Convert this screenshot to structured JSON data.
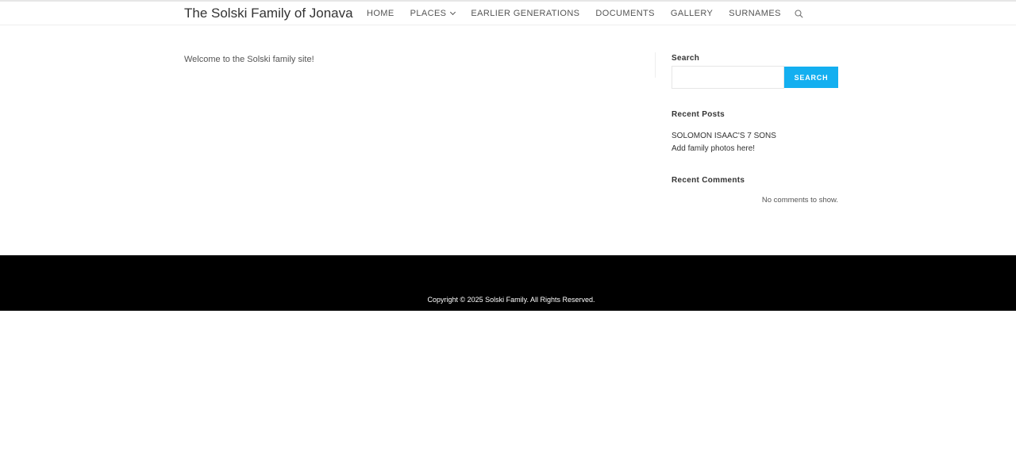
{
  "header": {
    "site_title": "The Solski Family of Jonava",
    "nav": [
      {
        "label": "HOME"
      },
      {
        "label": "PLACES"
      },
      {
        "label": "EARLIER GENERATIONS"
      },
      {
        "label": "DOCUMENTS"
      },
      {
        "label": "GALLERY"
      },
      {
        "label": "SURNAMES"
      }
    ],
    "search_icon": "search-icon"
  },
  "main": {
    "welcome_text": "Welcome to the Solski family site!"
  },
  "sidebar": {
    "search": {
      "title": "Search",
      "input_value": "",
      "button_label": "SEARCH"
    },
    "recent_posts": {
      "title": "Recent Posts",
      "items": [
        "SOLOMON ISAAC'S 7 SONS",
        "Add family photos here!"
      ]
    },
    "recent_comments": {
      "title": "Recent Comments",
      "empty_text": "No comments to show."
    }
  },
  "footer": {
    "copyright": "Copyright © 2025 Solski Family. All Rights Reserved."
  },
  "colors": {
    "accent": "#13aff0",
    "footer_bg": "#000000"
  }
}
